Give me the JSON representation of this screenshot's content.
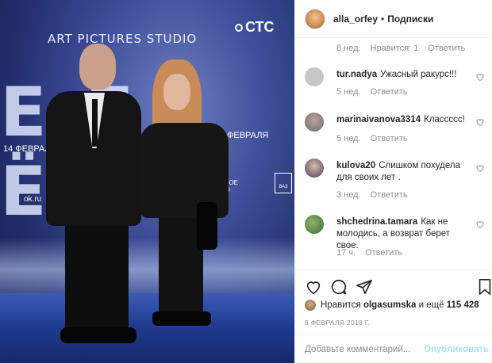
{
  "photo": {
    "studio_text": "ART PICTURES STUDIO",
    "channel_logo": "СТС",
    "big_letters": "ЕД ЁД",
    "date_left": "14 ФЕВРАЛЯ",
    "date_right": "ФЕВРАЛЯ",
    "radio_logo": "РУССКОЕ РАДИО",
    "ok_logo": "ok.ru",
    "vaz_logo": "ВАЗ"
  },
  "header": {
    "username": "alla_orfey",
    "separator": "•",
    "follow_label": "Подписки"
  },
  "top_meta": {
    "time": "8 нед.",
    "likes": "Нравится: 1",
    "reply": "Ответить"
  },
  "comments": [
    {
      "user": "tur.nadya",
      "text": "Ужасный ракурс!!!",
      "time": "5 нед.",
      "reply": "Ответить"
    },
    {
      "user": "marinaivanova3314",
      "text": "Классссс!",
      "time": "5 нед.",
      "reply": "Ответить"
    },
    {
      "user": "kulova20",
      "text": "Слишком похудела для своих лет .",
      "time": "3 нед.",
      "reply": "Ответить"
    },
    {
      "user": "shchedrina.tamara",
      "text": "Как не молодись, а возврат берет свое.",
      "time": "17 ч.",
      "reply": "Ответить"
    }
  ],
  "likes": {
    "prefix": "Нравится",
    "user": "olgasumska",
    "suffix": "и ещё",
    "count": "115 428"
  },
  "post_date": "8 ФЕВРАЛЯ 2018 Г.",
  "comment_box": {
    "placeholder": "Добавьте комментарий...",
    "publish_label": "Опубликовать"
  },
  "colors": {
    "accent_disabled": "#b2dffc",
    "text": "#262626",
    "muted": "#8e8e8e"
  }
}
